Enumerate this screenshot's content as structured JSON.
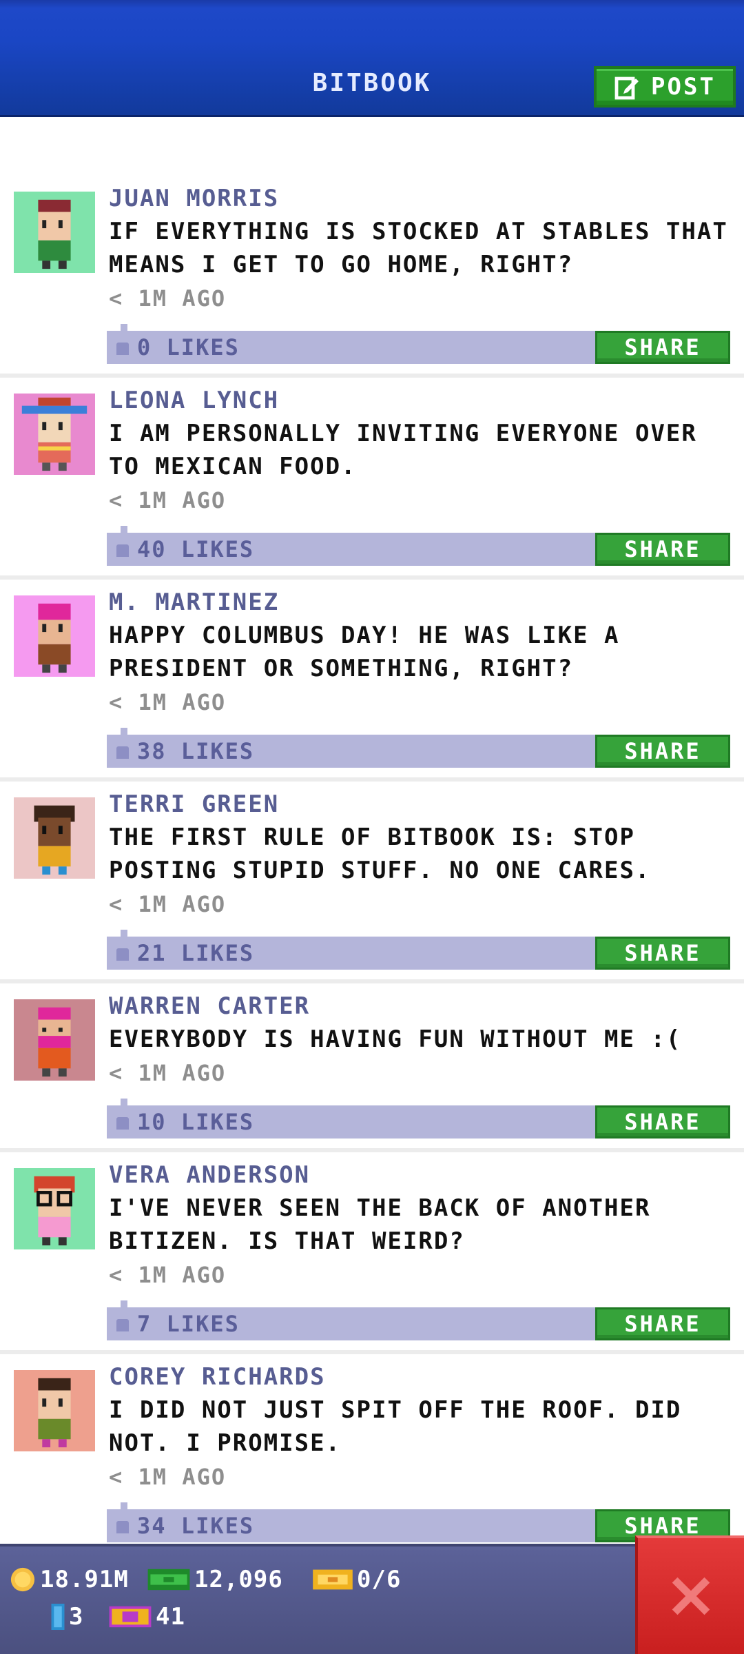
{
  "header": {
    "title": "BITBOOK",
    "post_label": "POST"
  },
  "posts": [
    {
      "name": "JUAN MORRIS",
      "text": "IF EVERYTHING IS STOCKED AT STABLES THAT MEANS I GET TO GO HOME, RIGHT?",
      "time": "< 1M AGO",
      "likes": "0 LIKES",
      "share": "SHARE",
      "avatar_bg": "#7fe3ab"
    },
    {
      "name": "LEONA LYNCH",
      "text": "I AM PERSONALLY INVITING EVERYONE OVER TO MEXICAN FOOD.",
      "time": "< 1M AGO",
      "likes": "40 LIKES",
      "share": "SHARE",
      "avatar_bg": "#e889cf"
    },
    {
      "name": "M. MARTINEZ",
      "text": "HAPPY COLUMBUS DAY! HE WAS LIKE A PRESIDENT OR SOMETHING, RIGHT?",
      "time": "< 1M AGO",
      "likes": "38 LIKES",
      "share": "SHARE",
      "avatar_bg": "#f59af0"
    },
    {
      "name": "TERRI GREEN",
      "text": "THE FIRST RULE OF BITBOOK IS: STOP POSTING STUPID STUFF. NO ONE CARES.",
      "time": "< 1M AGO",
      "likes": "21 LIKES",
      "share": "SHARE",
      "avatar_bg": "#ecc6c6"
    },
    {
      "name": "WARREN CARTER",
      "text": "EVERYBODY IS HAVING FUN WITHOUT ME :(",
      "time": "< 1M AGO",
      "likes": "10 LIKES",
      "share": "SHARE",
      "avatar_bg": "#c9878f"
    },
    {
      "name": "VERA ANDERSON",
      "text": "I'VE NEVER SEEN THE BACK OF ANOTHER BITIZEN. IS THAT WEIRD?",
      "time": "< 1M AGO",
      "likes": "7 LIKES",
      "share": "SHARE",
      "avatar_bg": "#7fe3ab"
    },
    {
      "name": "COREY RICHARDS",
      "text": "I DID NOT JUST SPIT OFF THE ROOF. DID NOT. I PROMISE.",
      "time": "< 1M AGO",
      "likes": "34 LIKES",
      "share": "SHARE",
      "avatar_bg": "#eea08e"
    }
  ],
  "status": {
    "coins": "18.91M",
    "bux": "12,096",
    "tickets": "0/6",
    "elevator": "3",
    "vip": "41"
  },
  "icons": {
    "post": "edit-icon",
    "like": "thumb-icon",
    "close": "close-icon",
    "coins": "coin-icon",
    "bux": "cash-icon",
    "tickets": "ticket-icon",
    "elevator": "elevator-icon",
    "vip": "vip-icon"
  },
  "colors": {
    "header": "#1e48c8",
    "share": "#36a33a",
    "likes_bar": "#b4b5da",
    "close": "#d62a2a",
    "footer": "#535888"
  }
}
